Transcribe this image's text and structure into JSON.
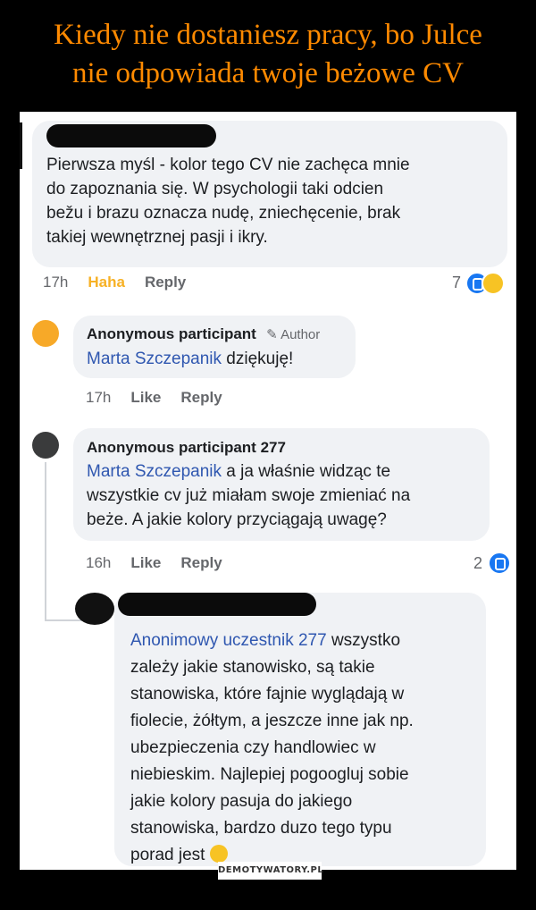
{
  "header": {
    "title_line1": "Kiedy nie dostaniesz pracy, bo Julce",
    "title_line2": "nie odpowiada twoje beżowe CV"
  },
  "comments": [
    {
      "lines": [
        "Pierwsza myśl - kolor tego CV nie zachęca mnie",
        "do zapoznania się. W psychologii taki odcien",
        "bežu i brazu oznacza nudę, zniechęcenie, brak",
        "takiej wewnętrznej pasji i ikry."
      ],
      "time": "17h",
      "reaction_label": "Haha",
      "reply": "Reply",
      "reaction_count": "7"
    },
    {
      "name": "Anonymous participant",
      "badge": "Author",
      "mention": "Marta Szczepanik",
      "text": " dziękuję!",
      "time": "17h",
      "like": "Like",
      "reply": "Reply"
    },
    {
      "name": "Anonymous participant 277",
      "mention": "Marta Szczepanik",
      "line1_rest": " a ja właśnie widząc te",
      "line2": "wszystkie cv już miałam swoje zmieniać na",
      "line3": "beże. A jakie kolory przyciągają uwagę?",
      "time": "16h",
      "like": "Like",
      "reply": "Reply",
      "reaction_count": "2"
    },
    {
      "mention": "Anonimowy uczestnik 277",
      "line1_rest": " wszystko",
      "lines": [
        "zależy jakie stanowisko, są takie",
        "stanowiska, które fajnie wyglądają w",
        "fiolecie, żółtym, a jeszcze inne jak np.",
        "ubezpieczenia czy handlowiec w",
        "niebieskim. Najlepiej pogoogluj sobie",
        "jakie kolory pasuja do jakiego",
        "stanowiska, bardzo duzo tego typu"
      ],
      "last_line": "porad jest"
    }
  ],
  "watermark": "DEMOTYWATORY.PL",
  "colors": {
    "title": "#ff8a00",
    "mention": "#2f57b0",
    "haha": "#f7b125",
    "like": "#1877f2"
  }
}
